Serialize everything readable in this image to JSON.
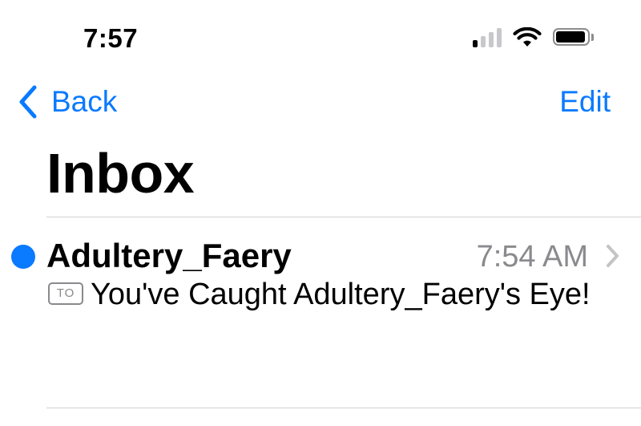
{
  "status_bar": {
    "time": "7:57",
    "icons": [
      "cellular-signal-icon",
      "wifi-icon",
      "battery-icon"
    ],
    "signal_bars_active": 1,
    "signal_bars_total": 4
  },
  "nav": {
    "back_label": "Back",
    "edit_label": "Edit"
  },
  "title": "Inbox",
  "messages": [
    {
      "unread": true,
      "sender": "Adultery_Faery",
      "time": "7:54 AM",
      "recipient_badge": "TO",
      "subject": "You've Caught Adultery_Faery's Eye!"
    }
  ],
  "colors": {
    "accent": "#0a7aff",
    "secondary_text": "#8a8a8e",
    "separator": "#d1d1d6",
    "background": "#ffffff"
  }
}
